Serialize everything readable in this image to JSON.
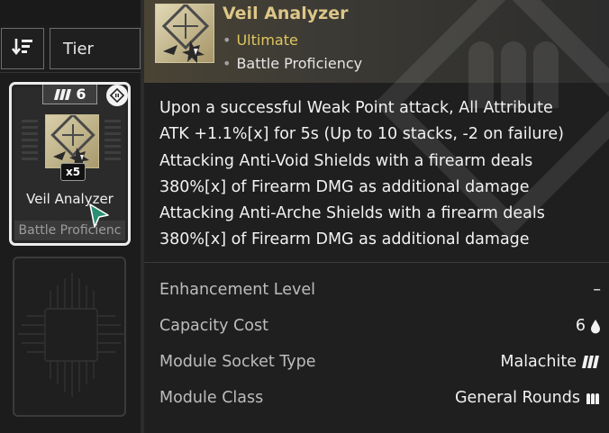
{
  "toolbar": {
    "sort_icon": "sort-descending-icon",
    "tier_label": "Tier"
  },
  "module_card": {
    "tier_badge": "6",
    "stack_label": "x5",
    "name": "Veil Analyzer",
    "socket_class": "Battle Proficienc"
  },
  "detail": {
    "name": "Veil Analyzer",
    "tags": [
      "Ultimate",
      "Battle Proficiency"
    ],
    "description_lines": [
      "Upon a successful Weak Point attack, All Attribute",
      "ATK +1.1%[x] for 5s (Up to 10 stacks, -2 on failure)",
      "Attacking Anti-Void Shields with a firearm deals",
      "380%[x] of Firearm DMG as additional damage",
      "Attacking Anti-Arche Shields with a firearm deals",
      "380%[x] of Firearm DMG as additional damage"
    ],
    "stats": [
      {
        "label": "Enhancement Level",
        "value": "–",
        "icon": ""
      },
      {
        "label": "Capacity Cost",
        "value": "6",
        "icon": "drop-icon"
      },
      {
        "label": "Module Socket Type",
        "value": "Malachite",
        "icon": "malachite-icon"
      },
      {
        "label": "Module Class",
        "value": "General Rounds",
        "icon": "rounds-icon"
      }
    ]
  },
  "colors": {
    "accent_gold": "#ddc687",
    "ultimate_yellow": "#e0c65f",
    "selected_border": "#ececec"
  }
}
